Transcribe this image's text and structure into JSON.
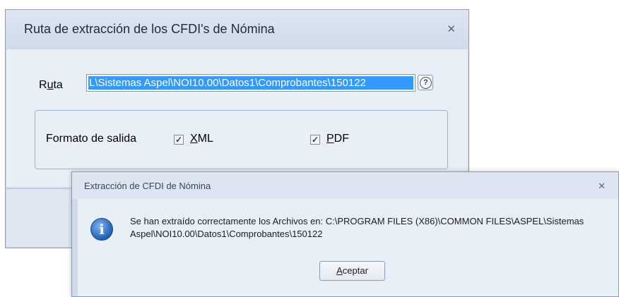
{
  "parent_dialog": {
    "title": "Ruta de extracción de los CFDI's de Nómina",
    "close_glyph": "✕",
    "ruta_label_pre": "R",
    "ruta_label_u": "u",
    "ruta_label_post": "ta",
    "ruta_value": "L\\Sistemas Aspel\\NOI10.00\\Datos1\\Comprobantes\\150122",
    "help_glyph": "?",
    "format_label": "Formato de salida",
    "xml_u": "X",
    "xml_rest": "ML",
    "xml_checked": true,
    "pdf_u": "P",
    "pdf_rest": "DF",
    "pdf_checked": true,
    "check_glyph": "✓"
  },
  "message_box": {
    "title": "Extracción de CFDI de Nómina",
    "close_glyph": "✕",
    "icon": "info-icon",
    "icon_glyph": "i",
    "message_line1": "Se han extraído correctamente los Archivos en: C:\\PROGRAM FILES (X86)\\COMMON FILES\\ASPEL\\Sistemas",
    "message_line2": "Aspel\\NOI10.00\\Datos1\\Comprobantes\\150122",
    "ok_u": "A",
    "ok_rest": "ceptar"
  }
}
